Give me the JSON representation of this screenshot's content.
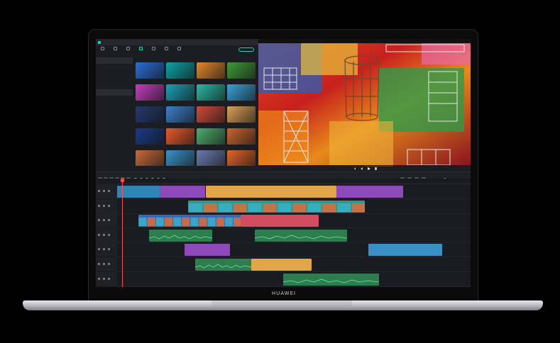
{
  "brand": "HUAWEI",
  "menu": {
    "items": [
      "",
      "",
      "",
      "",
      "",
      "",
      ""
    ]
  },
  "library": {
    "tabs": [
      {
        "label": ""
      },
      {
        "label": ""
      },
      {
        "label": ""
      },
      {
        "label": ""
      },
      {
        "label": ""
      },
      {
        "label": ""
      },
      {
        "label": ""
      }
    ],
    "import_label": "",
    "tree": [
      {
        "label": "",
        "count": "",
        "selected": true
      },
      {
        "label": "",
        "count": "",
        "selected": false
      },
      {
        "label": "",
        "count": "",
        "selected": false
      },
      {
        "label": "",
        "count": "",
        "selected": false
      },
      {
        "label": "",
        "count": "",
        "selected": false
      },
      {
        "label": "",
        "count": "",
        "selected": true
      },
      {
        "label": "",
        "count": "",
        "selected": false
      },
      {
        "label": "",
        "count": "",
        "selected": false
      },
      {
        "label": "",
        "count": "",
        "selected": false
      }
    ],
    "thumbnails": [
      {
        "color": "#2a6fd6",
        "caption": ""
      },
      {
        "color": "#0fa3a8",
        "caption": ""
      },
      {
        "color": "#e0892c",
        "caption": ""
      },
      {
        "color": "#3f9a3a",
        "caption": ""
      },
      {
        "color": "#c43fbd",
        "caption": ""
      },
      {
        "color": "#1e9fb5",
        "caption": ""
      },
      {
        "color": "#2bb8a4",
        "caption": ""
      },
      {
        "color": "#3aa0d8",
        "caption": ""
      },
      {
        "color": "#253a6e",
        "caption": ""
      },
      {
        "color": "#3c7fc8",
        "caption": ""
      },
      {
        "color": "#cf4b3a",
        "caption": ""
      },
      {
        "color": "#d9a05a",
        "caption": ""
      },
      {
        "color": "#1b3b86",
        "caption": ""
      },
      {
        "color": "#e85a2a",
        "caption": ""
      },
      {
        "color": "#4fae6a",
        "caption": ""
      },
      {
        "color": "#c8652e",
        "caption": ""
      },
      {
        "color": "#c96a3b",
        "caption": ""
      },
      {
        "color": "#3a93c9",
        "caption": ""
      },
      {
        "color": "#6a7bb0",
        "caption": ""
      },
      {
        "color": "#e2642a",
        "caption": ""
      }
    ]
  },
  "preview": {
    "title": "",
    "timecode": "",
    "zoom": ""
  },
  "timeline": {
    "ruler_ticks": [
      "",
      "",
      "",
      "",
      "",
      "",
      "",
      ""
    ],
    "tracks": [
      {
        "clips": [
          {
            "label": "",
            "color": "#2f86b5",
            "start": 0.0,
            "end": 0.12
          },
          {
            "label": "",
            "color": "#8d4ab8",
            "start": 0.12,
            "end": 0.25
          },
          {
            "label": "",
            "color": "#e2a64a",
            "start": 0.25,
            "end": 0.62
          },
          {
            "label": "",
            "color": "#8d4ab8",
            "start": 0.62,
            "end": 0.81
          }
        ]
      },
      {
        "clips": [
          {
            "label": "",
            "color": "#2e9a8a",
            "start": 0.2,
            "end": 0.7
          }
        ]
      },
      {
        "clips": [
          {
            "label": "",
            "color": "#3a6ab6",
            "start": 0.06,
            "end": 0.35
          },
          {
            "label": "",
            "color": "#d24d60",
            "start": 0.35,
            "end": 0.57
          }
        ]
      },
      {
        "clips": [
          {
            "label": "",
            "color": "#2e7d4e",
            "start": 0.09,
            "end": 0.27
          },
          {
            "label": "",
            "color": "#2e7d4e",
            "start": 0.39,
            "end": 0.65
          }
        ]
      },
      {
        "clips": [
          {
            "label": "",
            "color": "#8d4ab8",
            "start": 0.19,
            "end": 0.32
          },
          {
            "label": "",
            "color": "#3a8fc4",
            "start": 0.71,
            "end": 0.92
          }
        ]
      },
      {
        "clips": [
          {
            "label": "",
            "color": "#2e7d4e",
            "start": 0.22,
            "end": 0.38
          },
          {
            "label": "",
            "color": "#e2a64a",
            "start": 0.38,
            "end": 0.55
          }
        ]
      },
      {
        "clips": [
          {
            "label": "",
            "color": "#2e7d4e",
            "start": 0.47,
            "end": 0.74
          }
        ]
      }
    ]
  }
}
